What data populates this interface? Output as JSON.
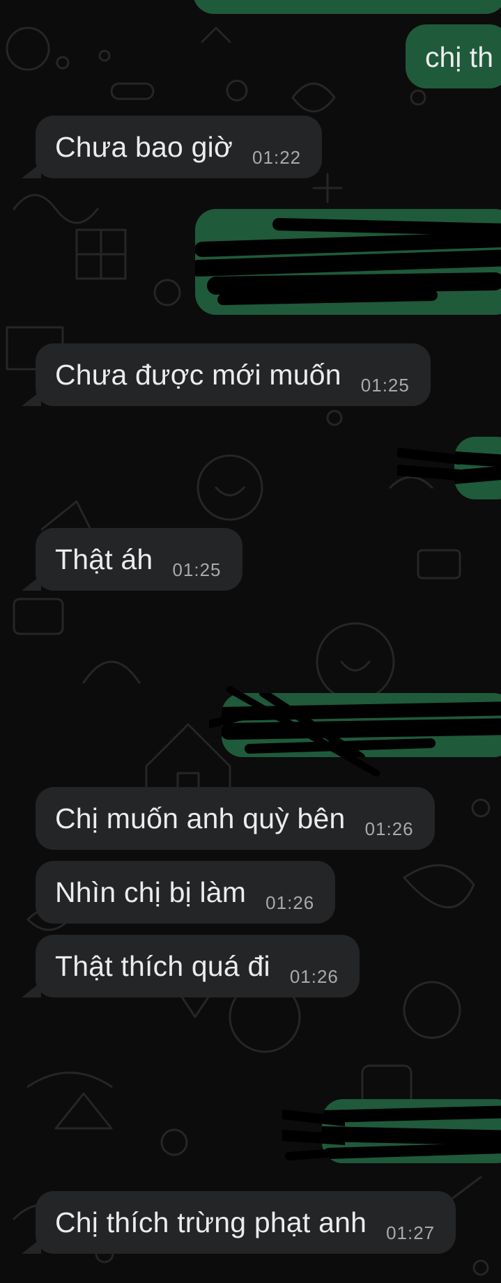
{
  "theme": {
    "background": "#0c0c0c",
    "incoming_bubble": "#242526",
    "outgoing_bubble": "#1f5a3b",
    "text": "#ececec",
    "timestamp": "#a8aaab"
  },
  "messages": [
    {
      "direction": "outgoing",
      "text": "chị th",
      "time": ""
    },
    {
      "direction": "incoming",
      "text": "Chưa bao giờ",
      "time": "01:22"
    },
    {
      "direction": "outgoing",
      "text": "",
      "time": "",
      "redacted": true
    },
    {
      "direction": "incoming",
      "text": "Chưa được mới muốn",
      "time": "01:25"
    },
    {
      "direction": "outgoing",
      "text": "",
      "time": "",
      "redacted": true
    },
    {
      "direction": "incoming",
      "text": "Thật áh",
      "time": "01:25"
    },
    {
      "direction": "outgoing",
      "text": "",
      "time": "",
      "redacted": true
    },
    {
      "direction": "incoming",
      "text": "Chị muốn anh quỳ bên",
      "time": "01:26"
    },
    {
      "direction": "incoming",
      "text": "Nhìn chị bị làm",
      "time": "01:26"
    },
    {
      "direction": "incoming",
      "text": "Thật thích quá đi",
      "time": "01:26"
    },
    {
      "direction": "outgoing",
      "text": "",
      "time": "",
      "redacted": true
    },
    {
      "direction": "incoming",
      "text": "Chị thích trừng phạt anh",
      "time": "01:27"
    }
  ]
}
